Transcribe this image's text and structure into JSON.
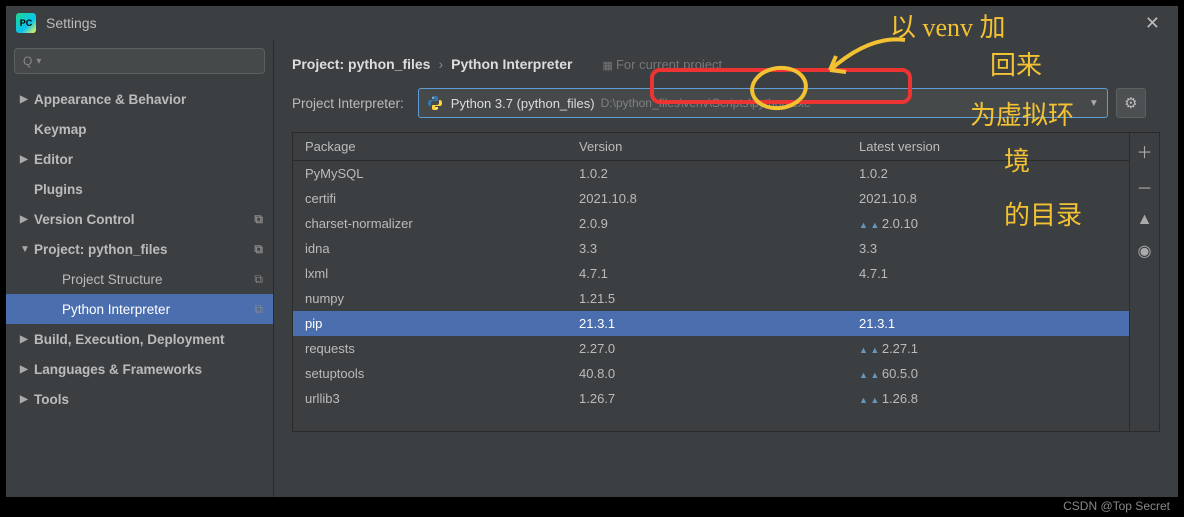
{
  "window": {
    "title": "Settings"
  },
  "search": {
    "placeholder": "Q"
  },
  "sidebar": {
    "items": [
      {
        "label": "Appearance & Behavior",
        "bold": true,
        "arrow": "▶"
      },
      {
        "label": "Keymap",
        "bold": true,
        "arrow": ""
      },
      {
        "label": "Editor",
        "bold": true,
        "arrow": "▶"
      },
      {
        "label": "Plugins",
        "bold": true,
        "arrow": ""
      },
      {
        "label": "Version Control",
        "bold": true,
        "arrow": "▶",
        "copy": true
      },
      {
        "label": "Project: python_files",
        "bold": true,
        "arrow": "▼",
        "copy": true
      },
      {
        "label": "Project Structure",
        "bold": false,
        "arrow": "",
        "child": true,
        "copy": true
      },
      {
        "label": "Python Interpreter",
        "bold": false,
        "arrow": "",
        "child": true,
        "copy": true,
        "selected": true
      },
      {
        "label": "Build, Execution, Deployment",
        "bold": true,
        "arrow": "▶"
      },
      {
        "label": "Languages & Frameworks",
        "bold": true,
        "arrow": "▶"
      },
      {
        "label": "Tools",
        "bold": true,
        "arrow": "▶"
      }
    ]
  },
  "breadcrumb": {
    "project_label": "Project: python_files",
    "current": "Python Interpreter",
    "hint": "For current project"
  },
  "interpreter": {
    "label": "Project Interpreter:",
    "name": "Python 3.7 (python_files)",
    "path": "D:\\python_files\\venv\\Scripts\\python.exe"
  },
  "table": {
    "headers": {
      "package": "Package",
      "version": "Version",
      "latest": "Latest version"
    },
    "rows": [
      {
        "pkg": "PyMySQL",
        "ver": "1.0.2",
        "latest": "1.0.2",
        "upd": false
      },
      {
        "pkg": "certifi",
        "ver": "2021.10.8",
        "latest": "2021.10.8",
        "upd": false
      },
      {
        "pkg": "charset-normalizer",
        "ver": "2.0.9",
        "latest": "2.0.10",
        "upd": true
      },
      {
        "pkg": "idna",
        "ver": "3.3",
        "latest": "3.3",
        "upd": false
      },
      {
        "pkg": "lxml",
        "ver": "4.7.1",
        "latest": "4.7.1",
        "upd": false
      },
      {
        "pkg": "numpy",
        "ver": "1.21.5",
        "latest": "",
        "upd": false
      },
      {
        "pkg": "pip",
        "ver": "21.3.1",
        "latest": "21.3.1",
        "upd": false,
        "selected": true
      },
      {
        "pkg": "requests",
        "ver": "2.27.0",
        "latest": "2.27.1",
        "upd": true
      },
      {
        "pkg": "setuptools",
        "ver": "40.8.0",
        "latest": "60.5.0",
        "upd": true
      },
      {
        "pkg": "urllib3",
        "ver": "1.26.7",
        "latest": "1.26.8",
        "upd": true
      }
    ]
  },
  "annotations": {
    "l1": "以 venv 加",
    "l2": "回来",
    "l3": "为虚拟环",
    "l4": "境",
    "l5": "的目录"
  },
  "watermark": "CSDN @Top Secret"
}
